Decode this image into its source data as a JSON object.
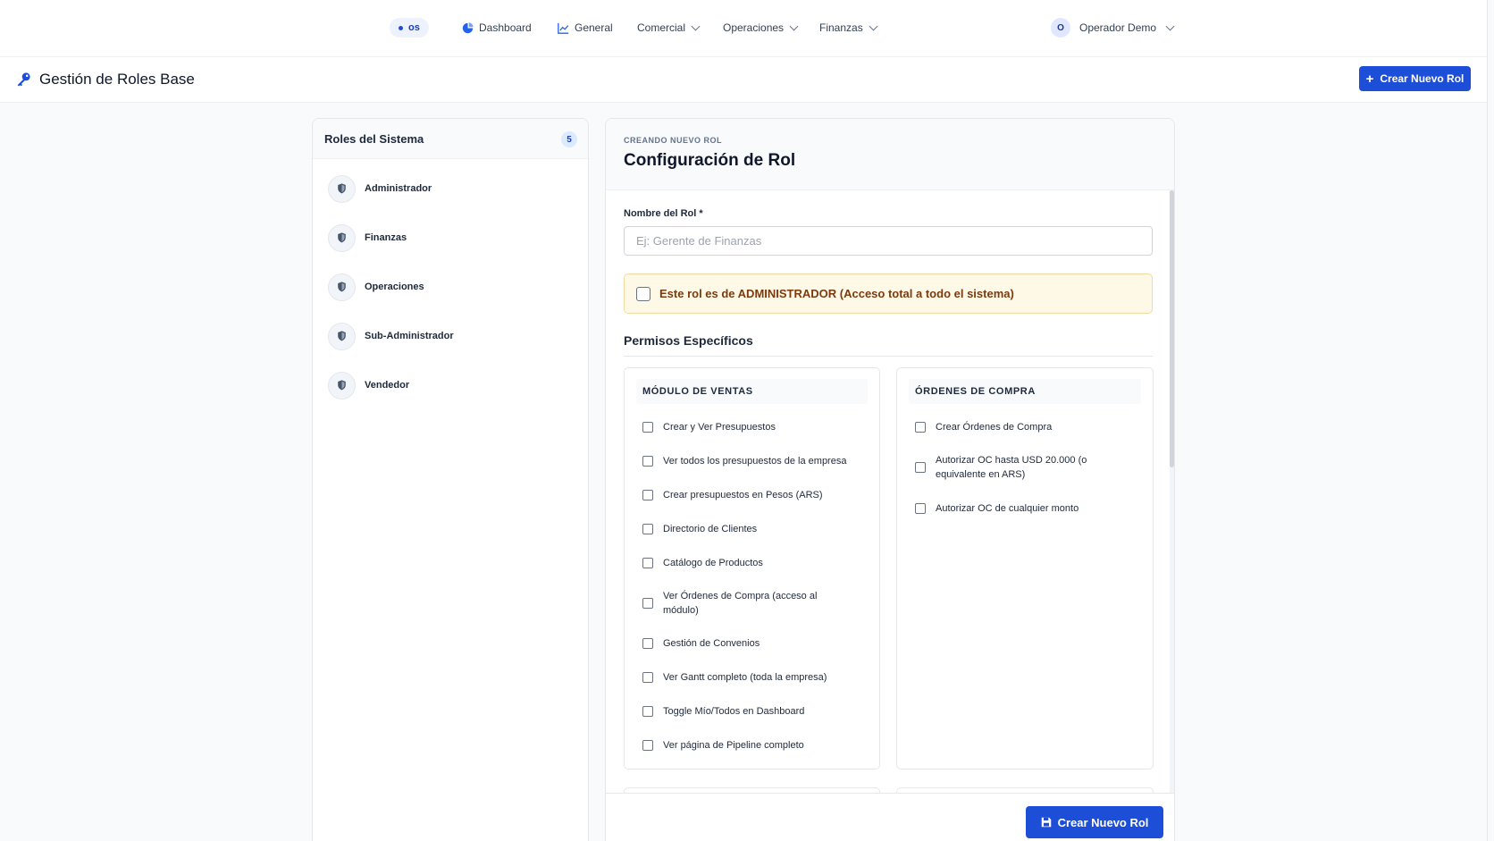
{
  "nav": {
    "brand": "os",
    "items": [
      {
        "label": "Dashboard",
        "icon": "pie-chart-icon"
      },
      {
        "label": "General",
        "icon": "line-chart-icon"
      },
      {
        "label": "Comercial"
      },
      {
        "label": "Operaciones"
      },
      {
        "label": "Finanzas"
      }
    ],
    "user": {
      "initial": "O",
      "name": "Operador Demo"
    }
  },
  "header": {
    "title": "Gestión de Roles Base",
    "create_button": "Crear Nuevo Rol"
  },
  "roles_panel": {
    "title": "Roles del Sistema",
    "count": "5",
    "roles": [
      "Administrador",
      "Finanzas",
      "Operaciones",
      "Sub-Administrador",
      "Vendedor"
    ]
  },
  "form": {
    "eyebrow": "CREANDO NUEVO ROL",
    "title": "Configuración de Rol",
    "name_label": "Nombre del Rol *",
    "name_placeholder": "Ej: Gerente de Finanzas",
    "name_value": "",
    "admin_label": "Este rol es de ADMINISTRADOR (Acceso total a todo el sistema)",
    "permissions_title": "Permisos Específicos",
    "modules": [
      {
        "title": "MÓDULO DE VENTAS",
        "permissions": [
          "Crear y Ver Presupuestos",
          "Ver todos los presupuestos de la empresa",
          "Crear presupuestos en Pesos (ARS)",
          "Directorio de Clientes",
          "Catálogo de Productos",
          "Ver Órdenes de Compra (acceso al módulo)",
          "Gestión de Convenios",
          "Ver Gantt completo (toda la empresa)",
          "Toggle Mío/Todos en Dashboard",
          "Ver página de Pipeline completo"
        ]
      },
      {
        "title": "ÓRDENES DE COMPRA",
        "permissions": [
          "Crear Órdenes de Compra",
          "Autorizar OC hasta USD 20.000 (o equivalente en ARS)",
          "Autorizar OC de cualquier monto"
        ]
      }
    ],
    "submit_button": "Crear Nuevo Rol"
  },
  "colors": {
    "primary": "#1d4ed8",
    "admin_bg": "#fef9e7",
    "admin_text": "#7c3a0e"
  }
}
